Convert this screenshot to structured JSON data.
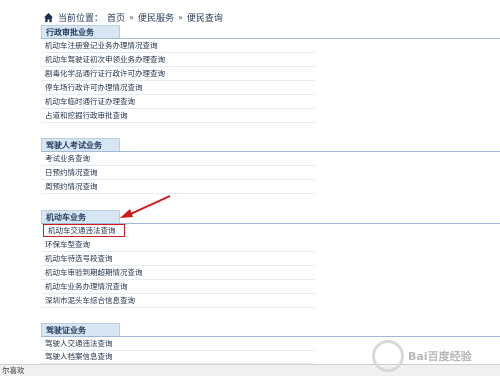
{
  "breadcrumb": {
    "label": "当前位置：",
    "home": "首页",
    "sep": "»",
    "level1": "便民服务",
    "level2": "便民查询"
  },
  "sections": [
    {
      "title": "行政审批业务",
      "items": [
        "机动车注册登记业务办理情况查询",
        "机动车驾驶证初次申领业务办理查询",
        "剧毒化学品通行证行政许可办理查询",
        "停车场行政许可办理情况查询",
        "机动车临时通行证办理查询",
        "占道和挖掘行政审批查询"
      ]
    },
    {
      "title": "驾驶人考试业务",
      "items": [
        "考试业务查询",
        "日预约情况查询",
        "周预约情况查询"
      ]
    },
    {
      "title": "机动车业务",
      "items": [
        "机动车交通违法查询",
        "环保车型查询",
        "机动车待选号段查询",
        "机动车审验到期超期情况查询",
        "机动车业务办理情况查询",
        "深圳市泥头车综合信息查询"
      ]
    },
    {
      "title": "驾驶证业务",
      "items": [
        "驾驶人交通违法查询",
        "驾驶人档案信息查询"
      ]
    }
  ],
  "status_text": "尔喜欢",
  "watermark_text": "Bai百度经验",
  "colors": {
    "highlight": "#d11a1a",
    "tab_bg": "#d8e6f3",
    "rule": "#9fbad8"
  }
}
